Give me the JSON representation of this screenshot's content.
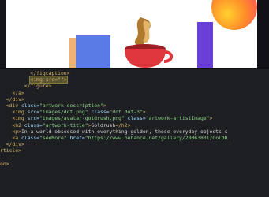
{
  "code_lines": [
    {
      "indent": "          ",
      "tag_open": "</figcaption>"
    },
    {
      "indent": "          ",
      "tag_open": "<img src=\"\">",
      "highlight": true
    },
    {
      "indent": "        ",
      "tag_open": "</figure>"
    },
    {
      "indent": "    ",
      "tag_open": "</a>"
    },
    {
      "indent": "  ",
      "tag_open": "</div>"
    },
    {
      "indent": "  ",
      "raw": [
        {
          "cls": "t",
          "text": "<div "
        },
        {
          "cls": "a",
          "text": "class="
        },
        {
          "cls": "v",
          "text": "\"artwork-description\""
        },
        {
          "cls": "t",
          "text": ">"
        }
      ]
    },
    {
      "indent": "    ",
      "raw": [
        {
          "cls": "t",
          "text": "<img "
        },
        {
          "cls": "a",
          "text": "src="
        },
        {
          "cls": "v",
          "text": "\"images/dot.png\""
        },
        {
          "cls": "a",
          "text": " class="
        },
        {
          "cls": "v",
          "text": "\"dot dot-3\""
        },
        {
          "cls": "t",
          "text": ">"
        }
      ]
    },
    {
      "indent": "    ",
      "raw": [
        {
          "cls": "t",
          "text": "<img "
        },
        {
          "cls": "a",
          "text": "src="
        },
        {
          "cls": "v",
          "text": "\"images/avatar-goldrush.png\""
        },
        {
          "cls": "a",
          "text": " class="
        },
        {
          "cls": "v",
          "text": "\"artwork-artistImage\""
        },
        {
          "cls": "t",
          "text": ">"
        }
      ]
    },
    {
      "indent": "    ",
      "raw": [
        {
          "cls": "t",
          "text": "<h2 "
        },
        {
          "cls": "a",
          "text": "class="
        },
        {
          "cls": "v",
          "text": "\"artwork-title\""
        },
        {
          "cls": "t",
          "text": ">"
        },
        {
          "cls": "tx",
          "text": "Goldrush"
        },
        {
          "cls": "t",
          "text": "</h2>"
        }
      ]
    },
    {
      "indent": "    ",
      "raw": [
        {
          "cls": "t",
          "text": "<p>"
        },
        {
          "cls": "tx",
          "text": "In a world obsessed with everything golden, these everyday objects s"
        }
      ]
    },
    {
      "indent": "    ",
      "raw": [
        {
          "cls": "t",
          "text": "<a "
        },
        {
          "cls": "a",
          "text": "class="
        },
        {
          "cls": "v",
          "text": "\"seeMore\""
        },
        {
          "cls": "a",
          "text": " href="
        },
        {
          "cls": "v",
          "text": "\"https://www.behance.net/gallery/28063831/GoldR"
        }
      ]
    },
    {
      "indent": "  ",
      "tag_open": "</div>"
    },
    {
      "indent": "",
      "tag_open": "rticle>"
    },
    {
      "indent": "",
      "tag_open": ""
    },
    {
      "indent": "",
      "tag_open": "on>"
    }
  ]
}
